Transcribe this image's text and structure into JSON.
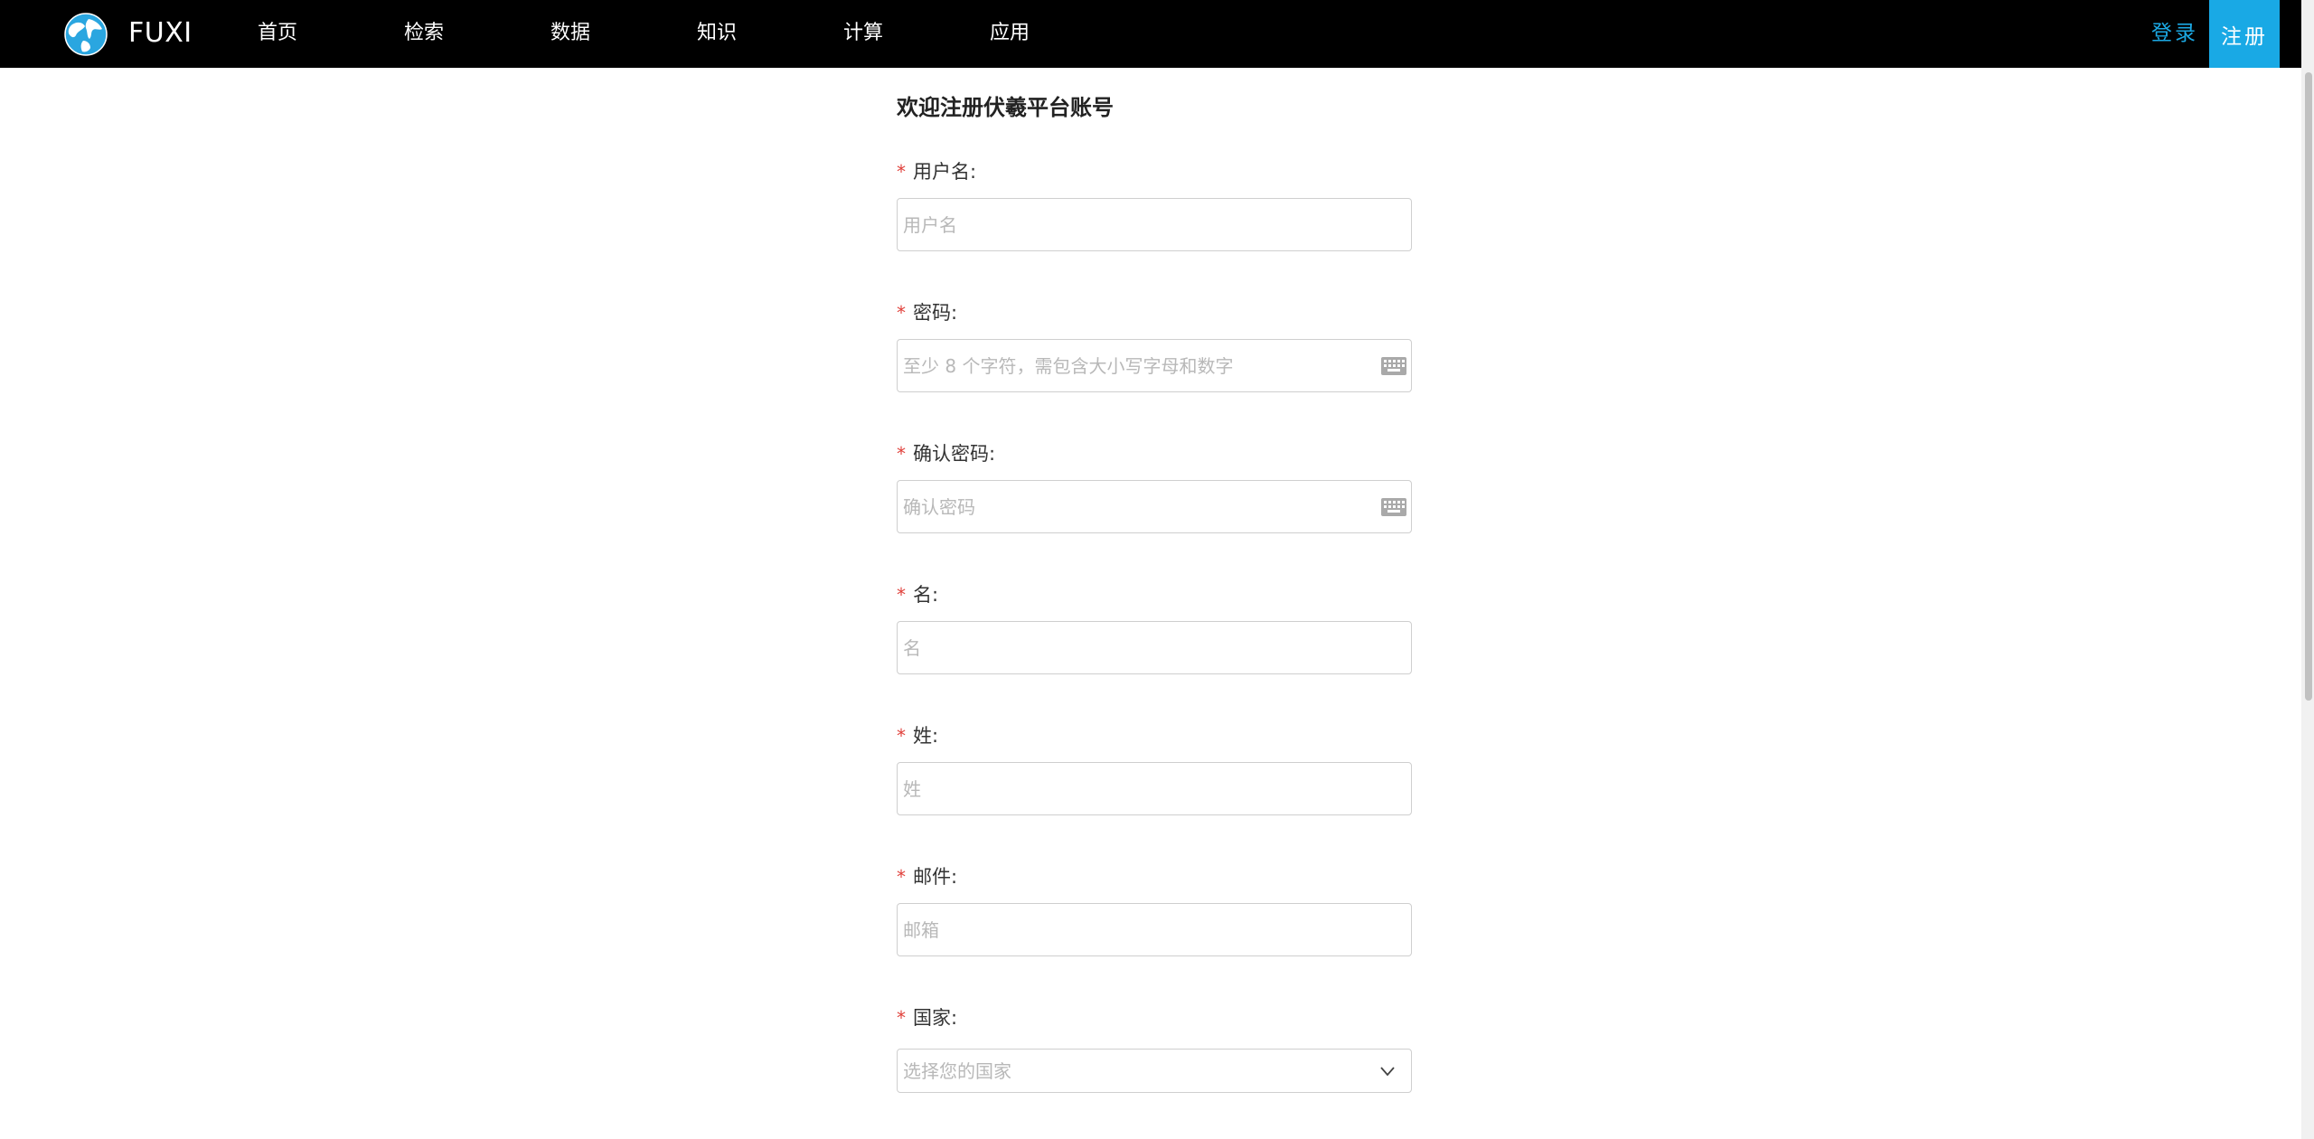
{
  "header": {
    "brand": "FUXI",
    "nav": [
      "首页",
      "检索",
      "数据",
      "知识",
      "计算",
      "应用"
    ],
    "login": "登录",
    "register": "注册"
  },
  "form": {
    "title": "欢迎注册伏羲平台账号",
    "required_mark": "*",
    "username": {
      "label": "用户名:",
      "placeholder": "用户名"
    },
    "password": {
      "label": "密码:",
      "placeholder": "至少 8 个字符，需包含大小写字母和数字"
    },
    "confirm_password": {
      "label": "确认密码:",
      "placeholder": "确认密码"
    },
    "first_name": {
      "label": "名:",
      "placeholder": "名"
    },
    "last_name": {
      "label": "姓:",
      "placeholder": "姓"
    },
    "email": {
      "label": "邮件:",
      "placeholder": "邮箱"
    },
    "country": {
      "label": "国家:",
      "placeholder": "选择您的国家"
    }
  },
  "colors": {
    "nav_bg": "#000000",
    "accent": "#19a9e5",
    "required": "#e0413b"
  }
}
